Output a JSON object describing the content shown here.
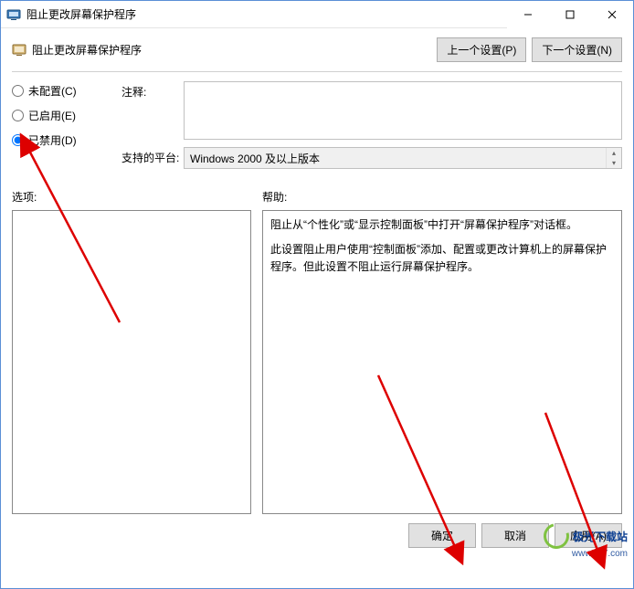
{
  "window": {
    "title": "阻止更改屏幕保护程序",
    "min_label": "—",
    "max_label": "□",
    "close_label": "✕"
  },
  "header": {
    "title": "阻止更改屏幕保护程序",
    "prev_setting": "上一个设置(P)",
    "next_setting": "下一个设置(N)"
  },
  "radios": {
    "not_configured": "未配置(C)",
    "enabled": "已启用(E)",
    "disabled": "已禁用(D)",
    "selected": "disabled"
  },
  "fields": {
    "comment_label": "注释:",
    "comment_value": "",
    "platform_label": "支持的平台:",
    "platform_value": "Windows 2000 及以上版本"
  },
  "lower": {
    "options_label": "选项:",
    "help_label": "帮助:",
    "help_paragraphs": [
      "阻止从“个性化”或“显示控制面板”中打开“屏幕保护程序”对话框。",
      "此设置阻止用户使用“控制面板”添加、配置或更改计算机上的屏幕保护程序。但此设置不阻止运行屏幕保护程序。"
    ]
  },
  "footer": {
    "ok": "确定",
    "cancel": "取消",
    "apply": "应用(A)"
  },
  "watermark": {
    "brand": "极光下载站",
    "url": "www.xz7.com"
  }
}
